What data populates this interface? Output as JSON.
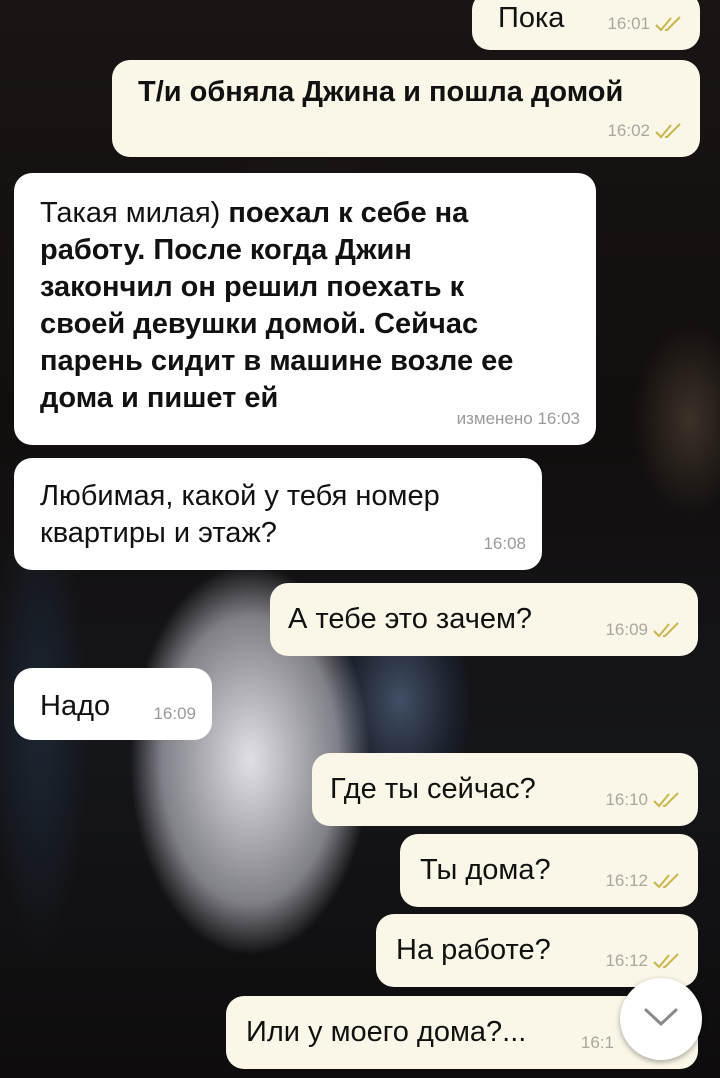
{
  "messages": [
    {
      "id": "m1",
      "direction": "out",
      "text": "Пока",
      "time": "16:01",
      "read": true
    },
    {
      "id": "m2",
      "direction": "out",
      "text": "Т/и обняла Джина и пошла домой",
      "time": "16:02",
      "read": true
    },
    {
      "id": "m3",
      "direction": "in",
      "text_normal": "Такая милая)",
      "text_bold": "поехал к себе на работу. После когда Джин закончил он решил поехать к своей девушки домой. Сейчас парень сидит в машине возле ее дома и пишет ей",
      "meta": "изменено 16:03"
    },
    {
      "id": "m4",
      "direction": "in",
      "text": "Любимая, какой у тебя номер квартиры и этаж?",
      "time": "16:08"
    },
    {
      "id": "m5",
      "direction": "out",
      "text": "А тебе это зачем?",
      "time": "16:09",
      "read": true
    },
    {
      "id": "m6",
      "direction": "in",
      "text": "Надо",
      "time": "16:09"
    },
    {
      "id": "m7",
      "direction": "out",
      "text": "Где ты сейчас?",
      "time": "16:10",
      "read": true
    },
    {
      "id": "m8",
      "direction": "out",
      "text": "Ты дома?",
      "time": "16:12",
      "read": true
    },
    {
      "id": "m9",
      "direction": "out",
      "text": "На работе?",
      "time": "16:12",
      "read": true
    },
    {
      "id": "m10",
      "direction": "out",
      "text": "Или у моего дома?...",
      "time": "16:1",
      "read": true
    }
  ],
  "icons": {
    "read_ticks": "double-check-icon",
    "scroll_down": "chevron-down-icon"
  },
  "colors": {
    "outgoing_bubble": "#fbf7e8",
    "incoming_bubble": "#ffffff",
    "tick_color": "#c9b54a"
  }
}
